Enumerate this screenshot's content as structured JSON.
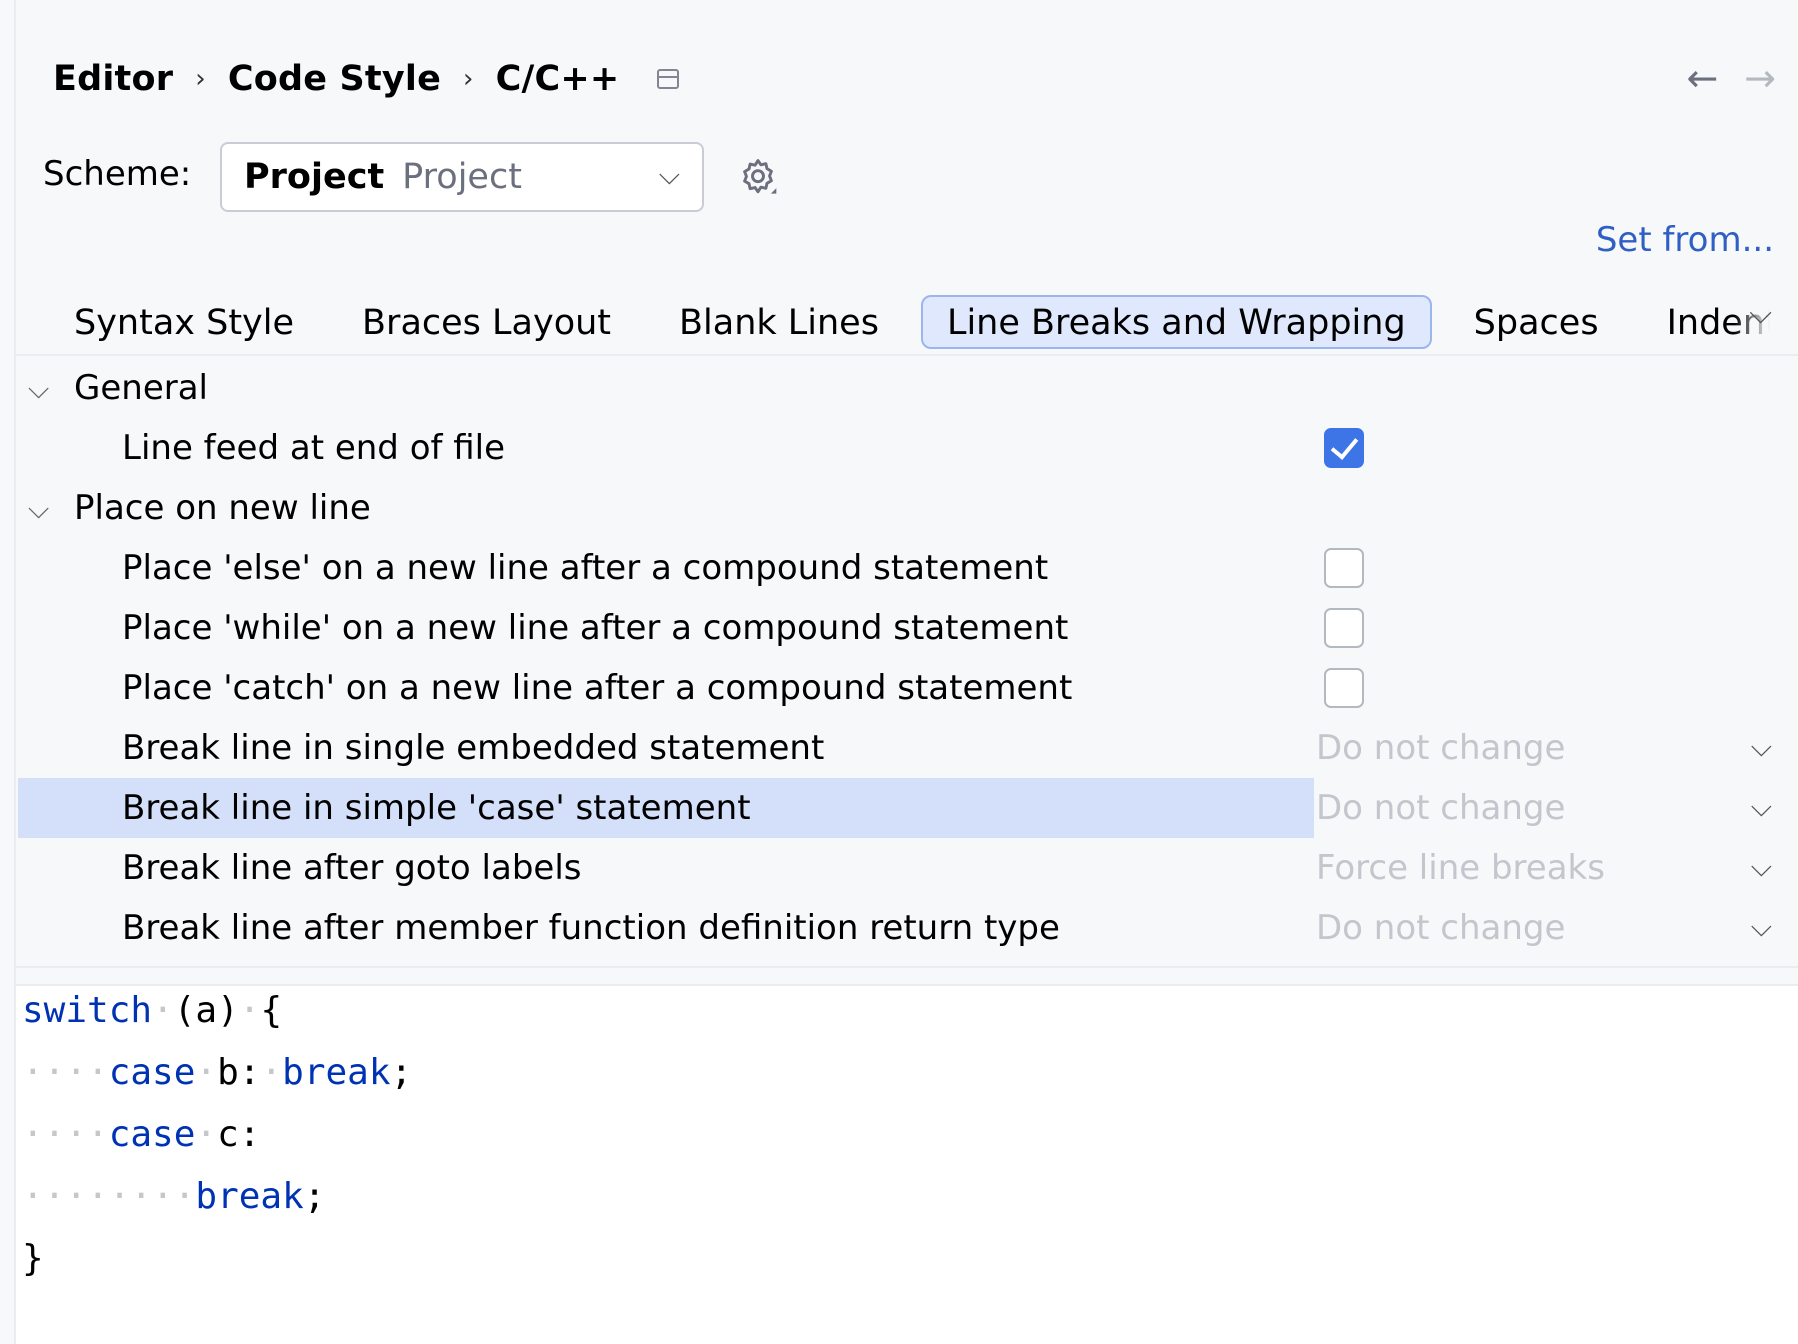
{
  "breadcrumb": {
    "items": [
      "Editor",
      "Code Style",
      "C/C++"
    ],
    "separator": "›"
  },
  "nav": {
    "back": "←",
    "forward": "→"
  },
  "scheme": {
    "label": "Scheme:",
    "primary": "Project",
    "secondary": "Project"
  },
  "set_from": "Set from...",
  "tabs": [
    {
      "label": "Syntax Style"
    },
    {
      "label": "Braces Layout"
    },
    {
      "label": "Blank Lines"
    },
    {
      "label": "Line Breaks and Wrapping",
      "selected": true
    },
    {
      "label": "Spaces"
    },
    {
      "label": "Indentat"
    }
  ],
  "options": {
    "general": {
      "label": "General",
      "line_feed": {
        "label": "Line feed at end of file",
        "checked": true
      }
    },
    "place_on_new_line": {
      "label": "Place on new line",
      "else": {
        "label": "Place 'else' on a new line after a compound statement",
        "checked": false
      },
      "while": {
        "label": "Place 'while' on a new line after a compound statement",
        "checked": false
      },
      "catch": {
        "label": "Place 'catch' on a new line after a compound statement",
        "checked": false
      },
      "single_embedded": {
        "label": "Break line in single embedded statement",
        "value": "Do not change"
      },
      "simple_case": {
        "label": "Break line in simple 'case' statement",
        "value": "Do not change"
      },
      "goto_labels": {
        "label": "Break line after goto labels",
        "value": "Force line breaks"
      },
      "member_return": {
        "label": "Break line after member function definition return type",
        "value": "Do not change"
      }
    }
  },
  "preview": {
    "line1": {
      "kw": "switch",
      "rest": "(a)",
      "brace": "{"
    },
    "line2": {
      "kw1": "case",
      "mid": "b:",
      "kw2": "break",
      "end": ";"
    },
    "line3": {
      "kw": "case",
      "rest": "c:"
    },
    "line4": {
      "kw": "break",
      "end": ";"
    },
    "line5": {
      "brace": "}"
    }
  },
  "colors": {
    "accent": "#3d74e6",
    "link": "#2f5fc4",
    "keyword": "#0033b3",
    "selection": "#d4e0fa"
  }
}
